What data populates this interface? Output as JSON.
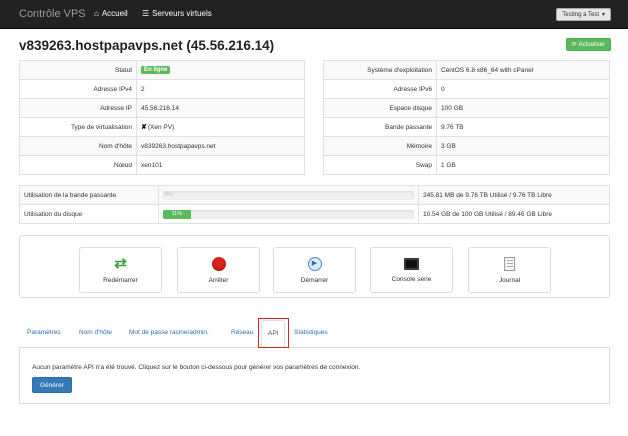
{
  "navbar": {
    "brand": "Contrôle VPS",
    "home_label": "Accueil",
    "servers_label": "Serveurs virtuels",
    "user_label": "Testing a Test"
  },
  "page": {
    "title": "v839263.hostpapavps.net (45.56.216.14)",
    "refresh_label": "Actualiser"
  },
  "info_left": [
    {
      "label": "Statut",
      "value": "En ligne"
    },
    {
      "label": "Adresse IPv4",
      "value": "2"
    },
    {
      "label": "Adresse IP",
      "value": "45.56.216.14"
    },
    {
      "label": "Type de virtualisation",
      "value": "(Xen PV)"
    },
    {
      "label": "Nom d'hôte",
      "value": "v839263.hostpapavps.net"
    },
    {
      "label": "Nœud",
      "value": "xen101"
    }
  ],
  "info_right": [
    {
      "label": "Système d'exploitation",
      "value": "CentOS 6.8 x86_64 with cPanel"
    },
    {
      "label": "Adresse IPv6",
      "value": "0"
    },
    {
      "label": "Espace disque",
      "value": "100 GB"
    },
    {
      "label": "Bande passante",
      "value": "9.76 TB"
    },
    {
      "label": "Mémoire",
      "value": "3 GB"
    },
    {
      "label": "Swap",
      "value": "1 GB"
    }
  ],
  "usage": [
    {
      "label": "Utilisation de la bande passante",
      "percent": 0,
      "bar_text": "0%",
      "detail": "245.81 MB de 9.76 TB Utilisé / 9.76 TB Libre"
    },
    {
      "label": "Utilisation du disque",
      "percent": 11,
      "bar_text": "11%",
      "detail": "10.54 GB de 100 GB Utilisé / 89.46 GB Libre"
    }
  ],
  "actions": [
    {
      "label": "Redémarrer",
      "icon": "restart-icon"
    },
    {
      "label": "Arrêter",
      "icon": "stop-icon"
    },
    {
      "label": "Démarrer",
      "icon": "play-icon"
    },
    {
      "label": "Console série",
      "icon": "console-icon"
    },
    {
      "label": "Journal",
      "icon": "journal-icon"
    }
  ],
  "tabs": [
    {
      "label": "Paramètres",
      "active": false
    },
    {
      "label": "Nom d'hôte",
      "active": false
    },
    {
      "label": "Mot de passe racine/admin.",
      "active": false
    },
    {
      "label": "Réseau",
      "active": false
    },
    {
      "label": "API",
      "active": true
    },
    {
      "label": "Statistiques",
      "active": false
    }
  ],
  "api": {
    "message": "Aucun paramètre API n'a été trouvé. Cliquez sur le bouton ci-dessous pour générer vos paramètres de connexion.",
    "generate_label": "Générer"
  },
  "colors": {
    "navbar": "#222222",
    "success": "#5cb85c",
    "primary": "#337ab7",
    "danger": "#d9211c",
    "link": "#2a6fb0"
  }
}
